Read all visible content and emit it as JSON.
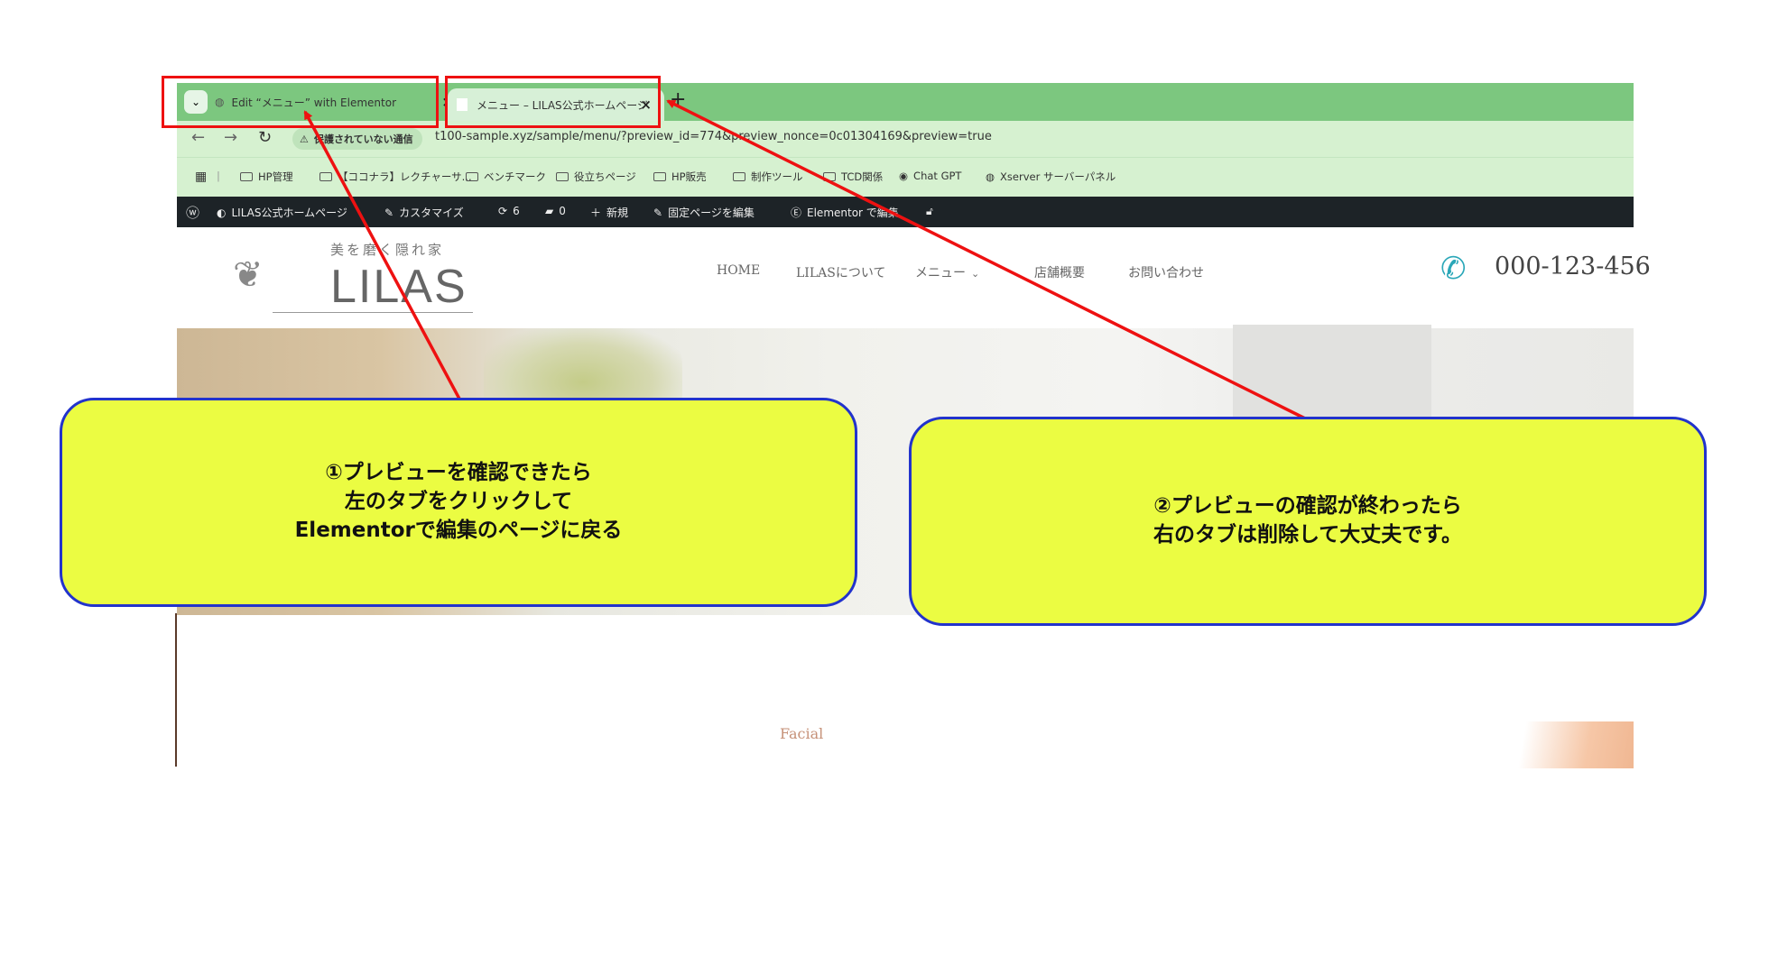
{
  "browser": {
    "tabs": [
      {
        "label": "Edit “メニュー” with Elementor",
        "active": true
      },
      {
        "label": "メニュー – LILAS公式ホームページ",
        "active": false
      }
    ],
    "tab_close": "×",
    "new_tab": "+",
    "security_chip": "保護されていない通信",
    "url": "t100-sample.xyz/sample/menu/?preview_id=774&preview_nonce=0c01304169&preview=true",
    "bookmarks": [
      "HP管理",
      "【ココナラ】レクチャーサ...",
      "ベンチマーク",
      "役立ちページ",
      "HP販売",
      "制作ツール",
      "TCD関係",
      "Chat GPT",
      "Xserver サーバーパネル"
    ]
  },
  "wp_admin_bar": {
    "site_name": "LILAS公式ホームページ",
    "customize": "カスタマイズ",
    "updates": "6",
    "comments": "0",
    "new": "新規",
    "edit_page": "固定ページを編集",
    "elementor": "Elementor で編集"
  },
  "site": {
    "tagline": "美を磨く隠れ家",
    "logo": "LILAS",
    "nav": [
      "HOME",
      "LILASについて",
      "メニュー",
      "店舗概要",
      "お問い合わせ"
    ],
    "phone": "000-123-456",
    "section_label": "Facial"
  },
  "annotations": {
    "callout_1": [
      "①プレビューを確認できたら",
      "左のタブをクリックして",
      "Elementorで編集のページに戻る"
    ],
    "callout_2": [
      "②プレビューの確認が終わったら",
      "右のタブは削除して大丈夫です。"
    ],
    "colors": {
      "arrow": "#ee1111",
      "callout_fill": "#ebfc42",
      "callout_border": "#2233cc"
    }
  }
}
